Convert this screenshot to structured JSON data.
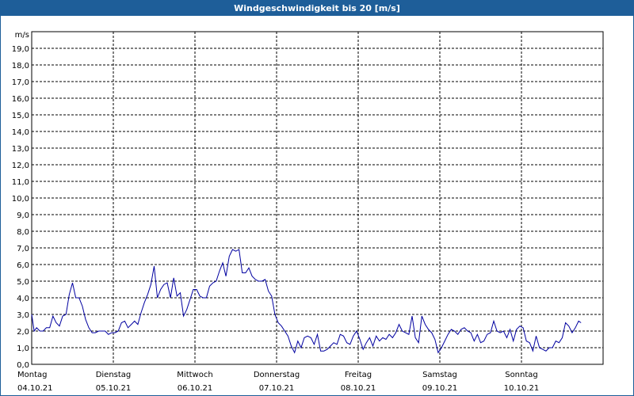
{
  "window": {
    "title": "Windgeschwindigkeit bis 20 [m/s]"
  },
  "chart_data": {
    "type": "line",
    "title": "Windgeschwindigkeit bis 20 [m/s]",
    "ylabel": "m/s",
    "ylim": [
      0,
      20
    ],
    "yticks": [
      "0,0",
      "1,0",
      "2,0",
      "3,0",
      "4,0",
      "5,0",
      "6,0",
      "7,0",
      "8,0",
      "9,0",
      "10,0",
      "11,0",
      "12,0",
      "13,0",
      "14,0",
      "15,0",
      "16,0",
      "17,0",
      "18,0",
      "19,0"
    ],
    "grid": true,
    "line_color": "#0000a0",
    "xlim": [
      0,
      7
    ],
    "days": [
      {
        "weekday": "Montag",
        "date": "04.10.21"
      },
      {
        "weekday": "Dienstag",
        "date": "05.10.21"
      },
      {
        "weekday": "Mittwoch",
        "date": "06.10.21"
      },
      {
        "weekday": "Donnerstag",
        "date": "07.10.21"
      },
      {
        "weekday": "Freitag",
        "date": "08.10.21"
      },
      {
        "weekday": "Samstag",
        "date": "09.10.21"
      },
      {
        "weekday": "Sonntag",
        "date": "10.10.21"
      }
    ],
    "series": [
      {
        "values": [
          [
            0.0,
            3.0
          ],
          [
            0.03,
            2.0
          ],
          [
            0.06,
            2.2
          ],
          [
            0.1,
            2.0
          ],
          [
            0.14,
            2.0
          ],
          [
            0.18,
            2.2
          ],
          [
            0.22,
            2.2
          ],
          [
            0.26,
            2.9
          ],
          [
            0.3,
            2.5
          ],
          [
            0.34,
            2.3
          ],
          [
            0.38,
            2.9
          ],
          [
            0.42,
            3.0
          ],
          [
            0.46,
            4.2
          ],
          [
            0.5,
            4.9
          ],
          [
            0.54,
            4.0
          ],
          [
            0.58,
            4.0
          ],
          [
            0.62,
            3.5
          ],
          [
            0.66,
            2.7
          ],
          [
            0.7,
            2.2
          ],
          [
            0.74,
            1.9
          ],
          [
            0.78,
            1.9
          ],
          [
            0.82,
            2.0
          ],
          [
            0.86,
            2.0
          ],
          [
            0.9,
            2.0
          ],
          [
            0.94,
            1.8
          ],
          [
            0.98,
            1.9
          ],
          [
            1.02,
            1.9
          ],
          [
            1.06,
            2.0
          ],
          [
            1.1,
            2.5
          ],
          [
            1.14,
            2.6
          ],
          [
            1.18,
            2.2
          ],
          [
            1.22,
            2.4
          ],
          [
            1.26,
            2.6
          ],
          [
            1.3,
            2.4
          ],
          [
            1.34,
            3.1
          ],
          [
            1.38,
            3.7
          ],
          [
            1.42,
            4.2
          ],
          [
            1.46,
            4.8
          ],
          [
            1.5,
            5.9
          ],
          [
            1.54,
            4.0
          ],
          [
            1.58,
            4.5
          ],
          [
            1.62,
            4.8
          ],
          [
            1.66,
            4.9
          ],
          [
            1.7,
            4.0
          ],
          [
            1.74,
            5.2
          ],
          [
            1.78,
            4.1
          ],
          [
            1.82,
            4.3
          ],
          [
            1.86,
            2.9
          ],
          [
            1.9,
            3.3
          ],
          [
            1.94,
            3.9
          ],
          [
            1.98,
            4.5
          ],
          [
            2.02,
            4.5
          ],
          [
            2.06,
            4.1
          ],
          [
            2.1,
            4.0
          ],
          [
            2.14,
            4.0
          ],
          [
            2.18,
            4.7
          ],
          [
            2.22,
            4.9
          ],
          [
            2.26,
            5.0
          ],
          [
            2.3,
            5.6
          ],
          [
            2.34,
            6.1
          ],
          [
            2.38,
            5.3
          ],
          [
            2.42,
            6.5
          ],
          [
            2.46,
            6.9
          ],
          [
            2.5,
            6.8
          ],
          [
            2.54,
            6.9
          ],
          [
            2.58,
            5.5
          ],
          [
            2.62,
            5.5
          ],
          [
            2.66,
            5.8
          ],
          [
            2.7,
            5.3
          ],
          [
            2.74,
            5.1
          ],
          [
            2.78,
            5.0
          ],
          [
            2.82,
            5.0
          ],
          [
            2.86,
            5.1
          ],
          [
            2.9,
            4.4
          ],
          [
            2.94,
            4.1
          ],
          [
            2.98,
            3.0
          ],
          [
            3.02,
            2.5
          ],
          [
            3.06,
            2.3
          ],
          [
            3.1,
            2.0
          ],
          [
            3.14,
            1.7
          ],
          [
            3.18,
            1.1
          ],
          [
            3.22,
            0.7
          ],
          [
            3.26,
            1.4
          ],
          [
            3.3,
            1.0
          ],
          [
            3.34,
            1.6
          ],
          [
            3.38,
            1.7
          ],
          [
            3.42,
            1.6
          ],
          [
            3.46,
            1.2
          ],
          [
            3.5,
            1.8
          ],
          [
            3.54,
            0.8
          ],
          [
            3.58,
            0.8
          ],
          [
            3.62,
            0.9
          ],
          [
            3.66,
            1.1
          ],
          [
            3.7,
            1.3
          ],
          [
            3.74,
            1.2
          ],
          [
            3.78,
            1.8
          ],
          [
            3.82,
            1.7
          ],
          [
            3.86,
            1.3
          ],
          [
            3.9,
            1.2
          ],
          [
            3.94,
            1.7
          ],
          [
            3.98,
            2.0
          ],
          [
            4.02,
            1.5
          ],
          [
            4.06,
            0.9
          ],
          [
            4.1,
            1.3
          ],
          [
            4.14,
            1.6
          ],
          [
            4.18,
            1.1
          ],
          [
            4.22,
            1.7
          ],
          [
            4.26,
            1.4
          ],
          [
            4.3,
            1.6
          ],
          [
            4.34,
            1.5
          ],
          [
            4.38,
            1.8
          ],
          [
            4.42,
            1.6
          ],
          [
            4.46,
            1.9
          ],
          [
            4.5,
            2.4
          ],
          [
            4.54,
            2.0
          ],
          [
            4.58,
            1.9
          ],
          [
            4.62,
            1.8
          ],
          [
            4.66,
            2.9
          ],
          [
            4.7,
            1.6
          ],
          [
            4.74,
            1.3
          ],
          [
            4.78,
            2.9
          ],
          [
            4.82,
            2.4
          ],
          [
            4.86,
            2.1
          ],
          [
            4.9,
            1.9
          ],
          [
            4.94,
            1.5
          ],
          [
            4.98,
            0.7
          ],
          [
            5.02,
            1.0
          ],
          [
            5.06,
            1.4
          ],
          [
            5.1,
            1.8
          ],
          [
            5.14,
            2.1
          ],
          [
            5.18,
            2.0
          ],
          [
            5.22,
            1.8
          ],
          [
            5.26,
            2.1
          ],
          [
            5.3,
            2.2
          ],
          [
            5.34,
            2.0
          ],
          [
            5.38,
            1.9
          ],
          [
            5.42,
            1.4
          ],
          [
            5.46,
            1.8
          ],
          [
            5.5,
            1.3
          ],
          [
            5.54,
            1.4
          ],
          [
            5.58,
            1.8
          ],
          [
            5.62,
            1.9
          ],
          [
            5.66,
            2.6
          ],
          [
            5.7,
            2.0
          ],
          [
            5.74,
            1.9
          ],
          [
            5.78,
            2.0
          ],
          [
            5.82,
            1.6
          ],
          [
            5.86,
            2.1
          ],
          [
            5.9,
            1.4
          ],
          [
            5.94,
            2.1
          ],
          [
            5.98,
            2.3
          ],
          [
            6.02,
            2.2
          ],
          [
            6.06,
            1.4
          ],
          [
            6.1,
            1.3
          ],
          [
            6.14,
            0.8
          ],
          [
            6.18,
            1.7
          ],
          [
            6.22,
            1.0
          ],
          [
            6.26,
            0.9
          ],
          [
            6.3,
            0.8
          ],
          [
            6.34,
            1.0
          ],
          [
            6.38,
            1.0
          ],
          [
            6.42,
            1.4
          ],
          [
            6.46,
            1.3
          ],
          [
            6.5,
            1.6
          ],
          [
            6.54,
            2.5
          ],
          [
            6.58,
            2.3
          ],
          [
            6.62,
            1.9
          ],
          [
            6.66,
            2.2
          ],
          [
            6.7,
            2.6
          ],
          [
            6.73,
            2.5
          ]
        ]
      }
    ]
  }
}
